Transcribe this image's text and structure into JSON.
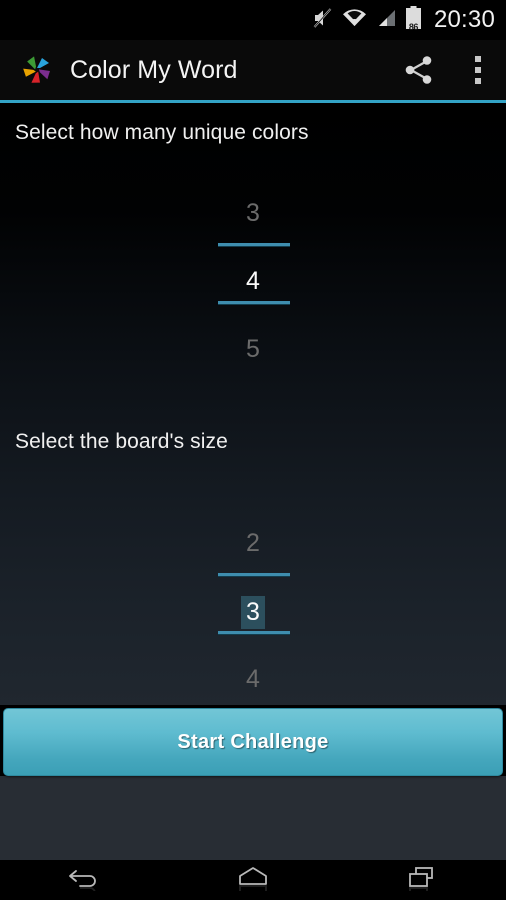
{
  "status_bar": {
    "icons": [
      "mute-icon",
      "wifi-icon",
      "cellular-signal-icon",
      "battery-icon"
    ],
    "battery_level": "86",
    "clock": "20:30"
  },
  "action_bar": {
    "app_icon": "pinwheel-app-icon",
    "title": "Color My Word",
    "share_label": "share-icon",
    "overflow_label": "overflow-menu-icon",
    "accent_color": "#33a3c6"
  },
  "content": {
    "colors_section": {
      "label": "Select how many unique colors",
      "picker": {
        "previous": "3",
        "current": "4",
        "next": "5",
        "divider_color": "#3e8dae"
      }
    },
    "size_section": {
      "label": "Select the board's size",
      "picker": {
        "previous": "2",
        "current": "3",
        "next": "4",
        "divider_color": "#3e8dae",
        "selection_highlight_color": "#2c4f5d"
      }
    }
  },
  "start_button": {
    "label": "Start Challenge",
    "color": "#5fbcd0"
  },
  "nav_bar": {
    "back": "back-icon",
    "home": "home-icon",
    "recents": "recents-icon"
  }
}
